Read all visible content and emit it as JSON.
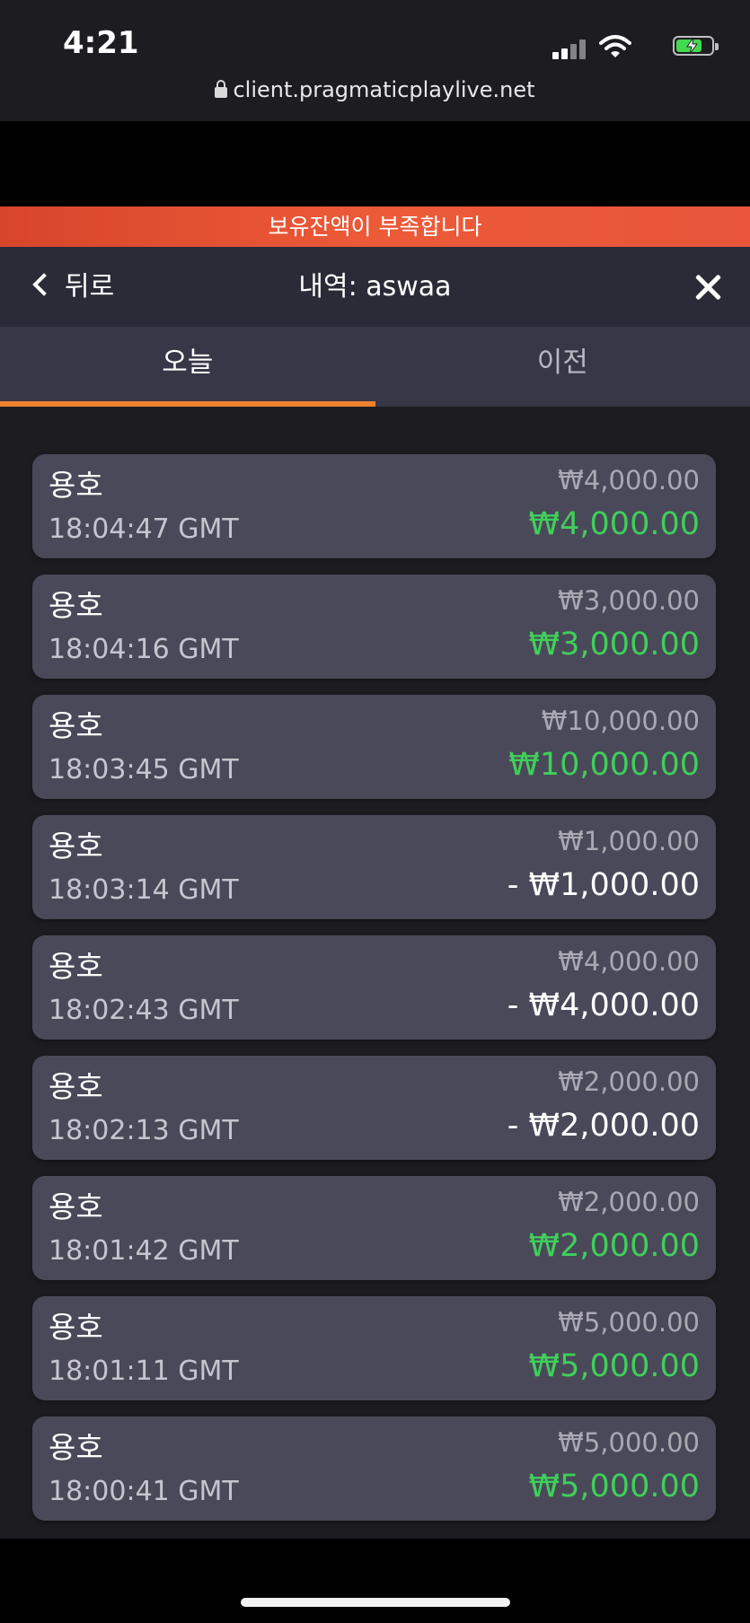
{
  "status_bar": {
    "time": "4:21",
    "url": "client.pragmaticplaylive.net",
    "icons": [
      "cellular-signal-icon",
      "wifi-icon",
      "battery-charging-icon"
    ]
  },
  "alert": {
    "message": "보유잔액이 부족합니다"
  },
  "header": {
    "back_label": "뒤로",
    "title": "내역: aswaa"
  },
  "tabs": [
    {
      "label": "오늘",
      "active": true
    },
    {
      "label": "이전",
      "active": false
    }
  ],
  "colors": {
    "accent": "#f0822e",
    "alert": "#e8553b",
    "win": "#3fcf5a",
    "card": "#4a4959",
    "background": "#1d1c21"
  },
  "history": [
    {
      "game": "용호",
      "time": "18:04:47 GMT",
      "bet": "₩4,000.00",
      "result": "₩4,000.00",
      "outcome": "win"
    },
    {
      "game": "용호",
      "time": "18:04:16 GMT",
      "bet": "₩3,000.00",
      "result": "₩3,000.00",
      "outcome": "win"
    },
    {
      "game": "용호",
      "time": "18:03:45 GMT",
      "bet": "₩10,000.00",
      "result": "₩10,000.00",
      "outcome": "win"
    },
    {
      "game": "용호",
      "time": "18:03:14 GMT",
      "bet": "₩1,000.00",
      "result": "- ₩1,000.00",
      "outcome": "loss"
    },
    {
      "game": "용호",
      "time": "18:02:43 GMT",
      "bet": "₩4,000.00",
      "result": "- ₩4,000.00",
      "outcome": "loss"
    },
    {
      "game": "용호",
      "time": "18:02:13 GMT",
      "bet": "₩2,000.00",
      "result": "- ₩2,000.00",
      "outcome": "loss"
    },
    {
      "game": "용호",
      "time": "18:01:42 GMT",
      "bet": "₩2,000.00",
      "result": "₩2,000.00",
      "outcome": "win"
    },
    {
      "game": "용호",
      "time": "18:01:11 GMT",
      "bet": "₩5,000.00",
      "result": "₩5,000.00",
      "outcome": "win"
    },
    {
      "game": "용호",
      "time": "18:00:41 GMT",
      "bet": "₩5,000.00",
      "result": "₩5,000.00",
      "outcome": "win"
    }
  ]
}
